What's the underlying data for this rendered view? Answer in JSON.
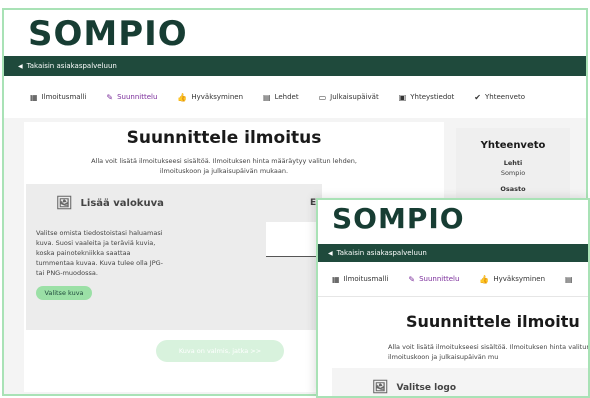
{
  "brand": {
    "logo": "SOMPIO"
  },
  "nav": {
    "back_link": "Takaisin asiakaspalveluun"
  },
  "steps": [
    {
      "label": "Ilmoitusmalli",
      "icon": "template-icon"
    },
    {
      "label": "Suunnittelu",
      "icon": "pencil-icon"
    },
    {
      "label": "Hyväksyminen",
      "icon": "thumbs-up-icon"
    },
    {
      "label": "Lehdet",
      "icon": "newspaper-icon"
    },
    {
      "label": "Julkaisupäivät",
      "icon": "calendar-icon"
    },
    {
      "label": "Yhteystiedot",
      "icon": "contact-icon"
    },
    {
      "label": "Yhteenveto",
      "icon": "check-icon"
    }
  ],
  "page": {
    "title": "Suunnittele ilmoitus",
    "description": "Alla voit lisätä ilmoitukseesi sisältöä. Ilmoituksen hinta määräytyy valitun lehden, ilmoituskoon ja julkaisupäivän mukaan."
  },
  "upload": {
    "title": "Lisää valokuva",
    "text": "Valitse omista tiedostoistasi haluamasi kuva. Suosi vaaleita ja teräviä kuvia, koska painotekniikka saattaa tummentaa kuvaa. Kuva tulee olla JPG- tai PNG-muodossa.",
    "button": "Valitse kuva"
  },
  "preview": {
    "label": "Es"
  },
  "ready_button": "Kuva on valmis, jatka  >>",
  "summary": {
    "title": "Yhteenveto",
    "paper_label": "Lehti",
    "paper_value": "Sompio",
    "section_label": "Osasto"
  },
  "front": {
    "back_link": "Takaisin asiakaspalveluun",
    "steps": [
      "Ilmoitusmalli",
      "Suunnittelu",
      "Hyväksyminen"
    ],
    "title": "Suunnittele ilmoitu",
    "description": "Alla voit lisätä ilmoitukseesi sisältöä. Ilmoituksen hinta valitun lehden, ilmoituskoon ja julkaisupäivän mu",
    "upload_title": "Valitse logo"
  },
  "colors": {
    "brand_dark": "#1f4a3c",
    "accent_green": "#9be0a6",
    "active_purple": "#7a2b9a"
  }
}
